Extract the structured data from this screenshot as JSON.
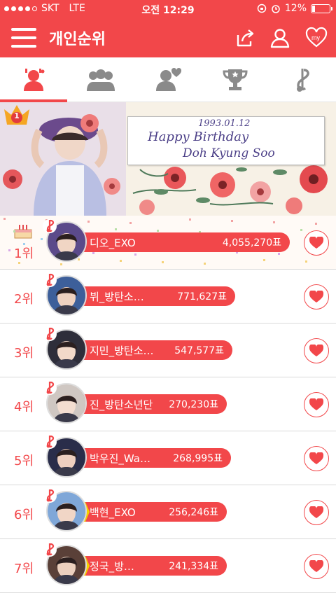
{
  "status_bar": {
    "carrier": "SKT",
    "network": "LTE",
    "time": "오전 12:29",
    "battery": "12%"
  },
  "header": {
    "title": "개인순위",
    "icons": [
      "menu-icon",
      "share-icon",
      "profile-icon",
      "my-heart-icon"
    ],
    "my_label": "my"
  },
  "tabs": [
    {
      "name": "individual-rank",
      "icon": "person-icon",
      "active": true
    },
    {
      "name": "group-rank",
      "icon": "group-icon",
      "active": false
    },
    {
      "name": "favorite-rank",
      "icon": "person-heart-icon",
      "active": false
    },
    {
      "name": "trophy-rank",
      "icon": "trophy-icon",
      "active": false
    },
    {
      "name": "music-rank",
      "icon": "music-note-icon",
      "active": false
    }
  ],
  "banner": {
    "badge": "1",
    "line1": "1993.01.12",
    "line2": "Happy Birthday",
    "line3": "Doh Kyung Soo"
  },
  "rankings": [
    {
      "rank": "1위",
      "name": "디오_EXO",
      "votes": "4,055,270표"
    },
    {
      "rank": "2위",
      "name": "뷔_방탄소…",
      "votes": "771,627표"
    },
    {
      "rank": "3위",
      "name": "지민_방탄소…",
      "votes": "547,577표"
    },
    {
      "rank": "4위",
      "name": "진_방탄소년단",
      "votes": "270,230표"
    },
    {
      "rank": "5위",
      "name": "박우진_Wa…",
      "votes": "268,995표"
    },
    {
      "rank": "6위",
      "name": "백현_EXO",
      "votes": "256,246표"
    },
    {
      "rank": "7위",
      "name": "정국_방…",
      "votes": "241,334표"
    }
  ],
  "colors": {
    "accent": "#f2474a",
    "tab_gray": "#8a8a8a"
  }
}
